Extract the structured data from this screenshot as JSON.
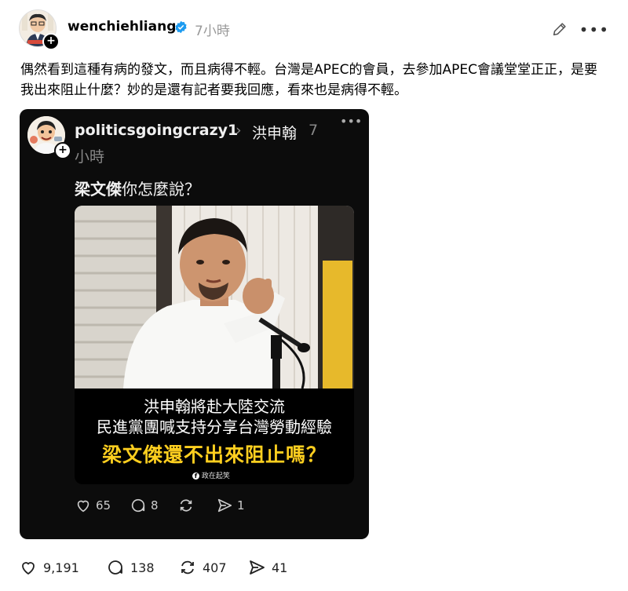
{
  "post": {
    "username": "wenchiehliang",
    "time": "7小時",
    "text": "偶然看到這種有病的發文，而且病得不輕。台灣是APEC的會員，去參加APEC會議堂堂正正，是要我出來阻止什麼？妙的是還有記者要我回應，看來也是病得不輕。",
    "likes": "9,191",
    "comments": "138",
    "reposts": "407",
    "shares": "41"
  },
  "quoted": {
    "username": "politicsgoingcrazy1",
    "target": "洪申翰",
    "time_part1": "7",
    "time_part2": "小時",
    "text_bold": "梁文傑",
    "text_rest": "你怎麼說？",
    "caption_line1": "洪申翰將赴大陸交流",
    "caption_line2": "民進黨團喊支持分享台灣勞動經驗",
    "caption_line3": "梁文傑還不出來阻止嗎？",
    "watermark": "政在起笑",
    "likes": "65",
    "comments": "8",
    "reposts": "",
    "shares": "1"
  },
  "colors": {
    "verified": "#1d9bf0",
    "caption_highlight": "#ffcf1f"
  },
  "icons": [
    "verified-icon",
    "edit-icon",
    "more-icon",
    "heart-icon",
    "comment-icon",
    "repost-icon",
    "share-icon",
    "plus-icon"
  ]
}
